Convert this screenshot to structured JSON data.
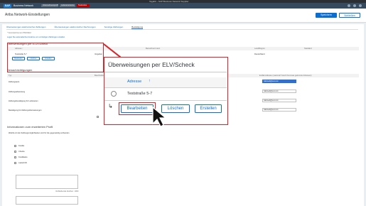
{
  "browser": {
    "title": "Tagalitt – SAP Business Network Supplier"
  },
  "shell": {
    "logo": "SAP",
    "title": "Business Network",
    "tags": [
      "Unternehmensprofil",
      "Lieferantenkonto",
      "Testmodus"
    ]
  },
  "header": {
    "title": "Ariba Network-Einstellungen",
    "save_label": "Speichern",
    "close_label": "Schließen"
  },
  "tabs": [
    "Überweisungen elektronischer Zahlungen",
    "Überweisungen elektronischer Rechnungen",
    "Sonstige Zahlungen",
    "Bestätigung"
  ],
  "notes": {
    "required": "* Kennzeichnet ein Pflichtfeld",
    "link": "Legen Sie automatische Annahme von vorzeitigen Zahlungen erstellen"
  },
  "remit": {
    "section_title": "Überweisungen per ELV/Scheck",
    "col_address": "Adresse ↑",
    "col_id": "Bezeichnet Intern",
    "col_country": "Land/Region",
    "col_default": "Standard",
    "row_street": "Teststraße 5-7",
    "row_value": "Vergeben",
    "row_country": "Deutschland",
    "btn_edit": "Bearbeiten",
    "btn_delete": "Löschen",
    "btn_create": "Erstellen"
  },
  "notif": {
    "section_title": "Benachrichtigungen",
    "col_type": "Typ",
    "col_desc": "Beschreibung",
    "col_email": "E-Mail-Adresse (maximal 5 durch Kommas getrennte Adressen)",
    "rows": [
      {
        "type": "Zahlungsavis",
        "email": "hallowelt@test.com"
      },
      {
        "type": "Zahlungsabweisung",
        "email": "hallowelt@test.com"
      },
      {
        "type": "Zahlungsbestätigung für Lieferanten",
        "email": "hallowelt@test.com"
      },
      {
        "type": "Bestätigung für Zahlungsüberweisungen",
        "email": "hallowelt@test.com"
      }
    ]
  },
  "profile": {
    "section_title": "Informationen zum erweiterten Profil",
    "question": "Welche Art der Zahlungsmöglichkeiten sind für die gegenwärtig vorhanden",
    "options": [
      "Kredite",
      "Checks",
      "Kreditkarte",
      "Lastschrift"
    ],
    "counter_label": "Verbleibende Zeichen: 1000"
  },
  "zoom": {
    "title": "Überweisungen per ELV/Scheck",
    "col_address": "Adresse",
    "sort_arrow": "↑",
    "row_street": "Teststraße 5-7",
    "hook": "↳",
    "btn_edit": "Bearbeiten",
    "btn_delete": "Löschen",
    "btn_create": "Erstellen"
  }
}
